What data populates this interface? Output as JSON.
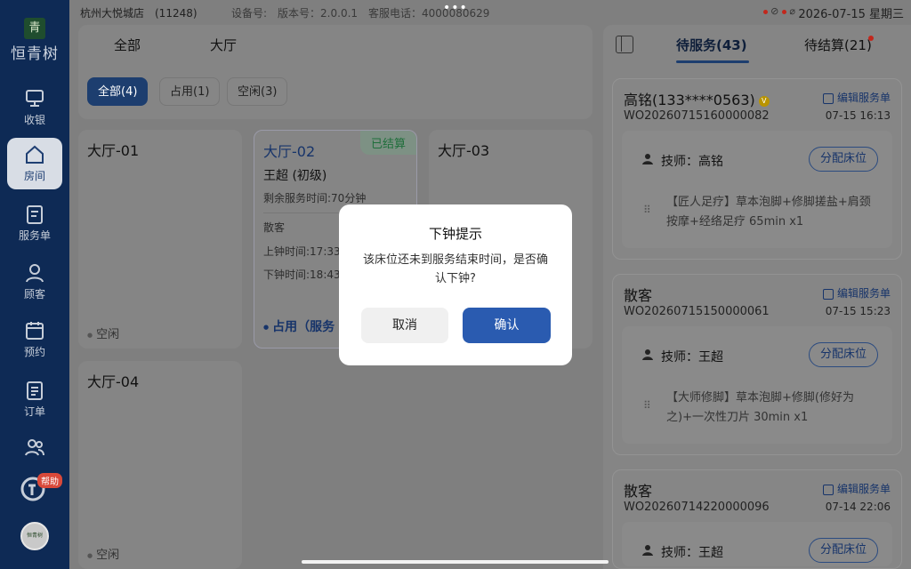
{
  "status_bar": {
    "store": "杭州大悦城店　(11248)",
    "meta": "设备号:　版本号：2.0.0.1　客服电话：4000080629",
    "dots": "•••",
    "datetime": "2026-07-15 星期三"
  },
  "sidebar": {
    "logo_mark": "青",
    "logo_text": "恒青树",
    "items": [
      {
        "label": "收银",
        "icon": "cashier-icon"
      },
      {
        "label": "房间",
        "icon": "home-icon"
      },
      {
        "label": "服务单",
        "icon": "service-order-icon"
      },
      {
        "label": "顾客",
        "icon": "customer-icon"
      },
      {
        "label": "预约",
        "icon": "calendar-icon"
      },
      {
        "label": "订单",
        "icon": "order-icon"
      },
      {
        "label": "",
        "icon": "staff-icon"
      }
    ],
    "help_badge": "帮助",
    "avatar_text": "恒青树"
  },
  "main": {
    "tabs": [
      "全部",
      "大厅"
    ],
    "filters": [
      "全部(4)",
      "占用(1)",
      "空闲(3)"
    ],
    "beds": [
      {
        "title": "大厅-01",
        "status": "空闲"
      },
      {
        "title": "大厅-02",
        "badge": "已结算",
        "name": "王超 (初级)",
        "remaining": "剩余服务时间:70分钟",
        "guest": "散客",
        "start": "上钟时间:17:33",
        "end": "下钟时间:18:43",
        "footer": "占用（服务"
      },
      {
        "title": "大厅-03"
      },
      {
        "title": "大厅-04",
        "status": "空闲"
      }
    ]
  },
  "panel": {
    "tab_active": "待服务(43)",
    "tab_other": "待结算(21)",
    "edit_label": "编辑服务单",
    "assign_label": "分配床位",
    "orders": [
      {
        "customer": "高铭(133****0563)",
        "vip": "V",
        "no": "WO20260715160000082",
        "time": "07-15 16:13",
        "tech": "技师：高铭",
        "service": "【匠人足疗】草本泡脚+修脚搓盐+肩颈按摩+经络足疗 65min x1"
      },
      {
        "customer": "散客",
        "no": "WO20260715150000061",
        "time": "07-15 15:23",
        "tech": "技师：王超",
        "service": "【大师修脚】草本泡脚+修脚(修好为之)+一次性刀片 30min x1"
      },
      {
        "customer": "散客",
        "no": "WO20260714220000096",
        "time": "07-14 22:06",
        "tech": "技师：王超",
        "service": ""
      }
    ]
  },
  "modal": {
    "title": "下钟提示",
    "text": "该床位还未到服务结束时间，是否确认下钟?",
    "cancel": "取消",
    "confirm": "确认"
  },
  "colors": {
    "accent": "#2a5bb0",
    "sidebar": "#0e2a55",
    "overlay": "#7f7f7f"
  }
}
